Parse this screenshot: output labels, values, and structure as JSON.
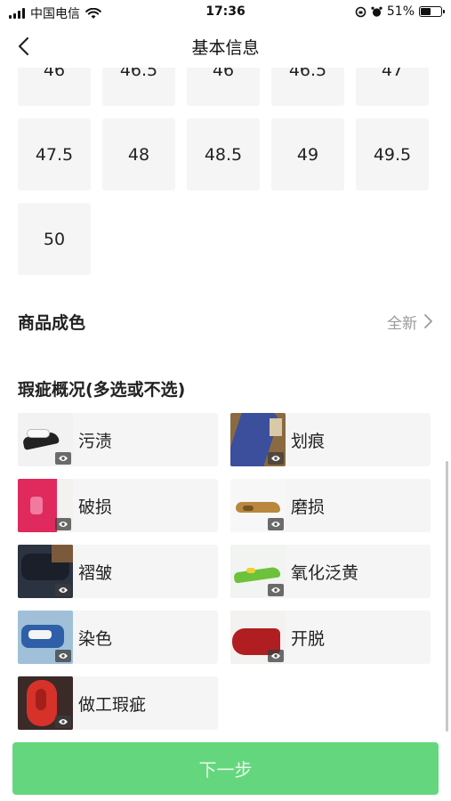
{
  "status_bar": {
    "carrier": "中国电信",
    "time": "17:36",
    "battery": "51%",
    "battery_level": 0.51
  },
  "nav": {
    "title": "基本信息",
    "back_icon": "chevron-left-icon"
  },
  "sizes": {
    "rows": [
      [
        "46",
        "46.5",
        "46",
        "46.5",
        "47"
      ],
      [
        "47.5",
        "48",
        "48.5",
        "49",
        "49.5"
      ],
      [
        "50"
      ]
    ]
  },
  "condition": {
    "label": "商品成色",
    "value": "全新"
  },
  "defects": {
    "title": "瑕疵概况(多选或不选)",
    "items": [
      {
        "label": "污渍"
      },
      {
        "label": "划痕"
      },
      {
        "label": "破损"
      },
      {
        "label": "磨损"
      },
      {
        "label": "褶皱"
      },
      {
        "label": "氧化泛黄"
      },
      {
        "label": "染色"
      },
      {
        "label": "开脱"
      },
      {
        "label": "做工瑕疵"
      }
    ]
  },
  "footer": {
    "next_label": "下一步"
  },
  "colors": {
    "accent": "#64d77e",
    "cell_bg": "#f5f5f5",
    "muted_text": "#9a9a9a"
  }
}
